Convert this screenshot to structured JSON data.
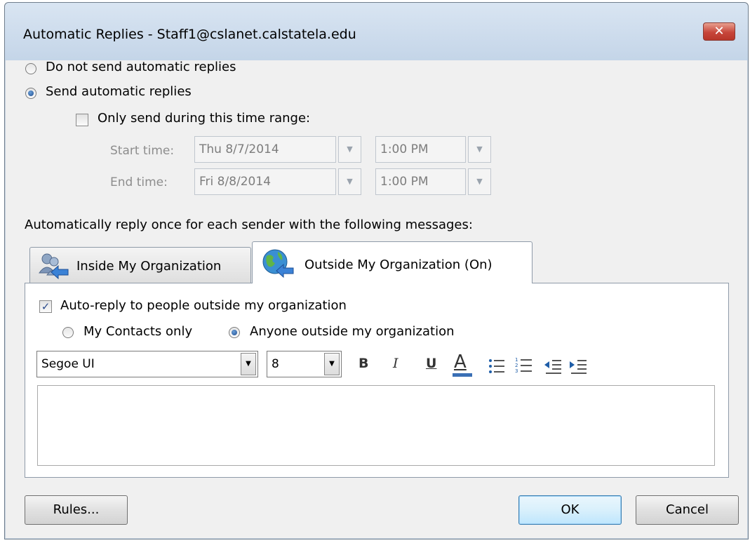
{
  "window": {
    "title": "Automatic Replies - Staff1@cslanet.calstatela.edu",
    "close_glyph": "✕"
  },
  "options": {
    "do_not_send": "Do not send automatic replies",
    "send": "Send automatic replies",
    "time_range": "Only send during this time range:",
    "start_label": "Start time:",
    "start_date": "Thu 8/7/2014",
    "start_time": "1:00 PM",
    "end_label": "End time:",
    "end_date": "Fri 8/8/2014",
    "end_time": "1:00 PM"
  },
  "reply_heading": "Automatically reply once for each sender with the following messages:",
  "tabs": [
    {
      "label": "Inside My Organization",
      "icon": "people-arrow-icon"
    },
    {
      "label": "Outside My Organization (On)",
      "icon": "globe-arrow-icon"
    }
  ],
  "outside": {
    "auto_reply": "Auto-reply to people outside my organization",
    "contacts_only": "My Contacts only",
    "anyone": "Anyone outside my organization"
  },
  "toolbar": {
    "font": "Segoe UI",
    "size": "8",
    "bold": "B",
    "italic": "I",
    "underline": "U",
    "font_color": "A",
    "accent": "#3a6fb5"
  },
  "buttons": {
    "rules": "Rules...",
    "ok": "OK",
    "cancel": "Cancel"
  }
}
